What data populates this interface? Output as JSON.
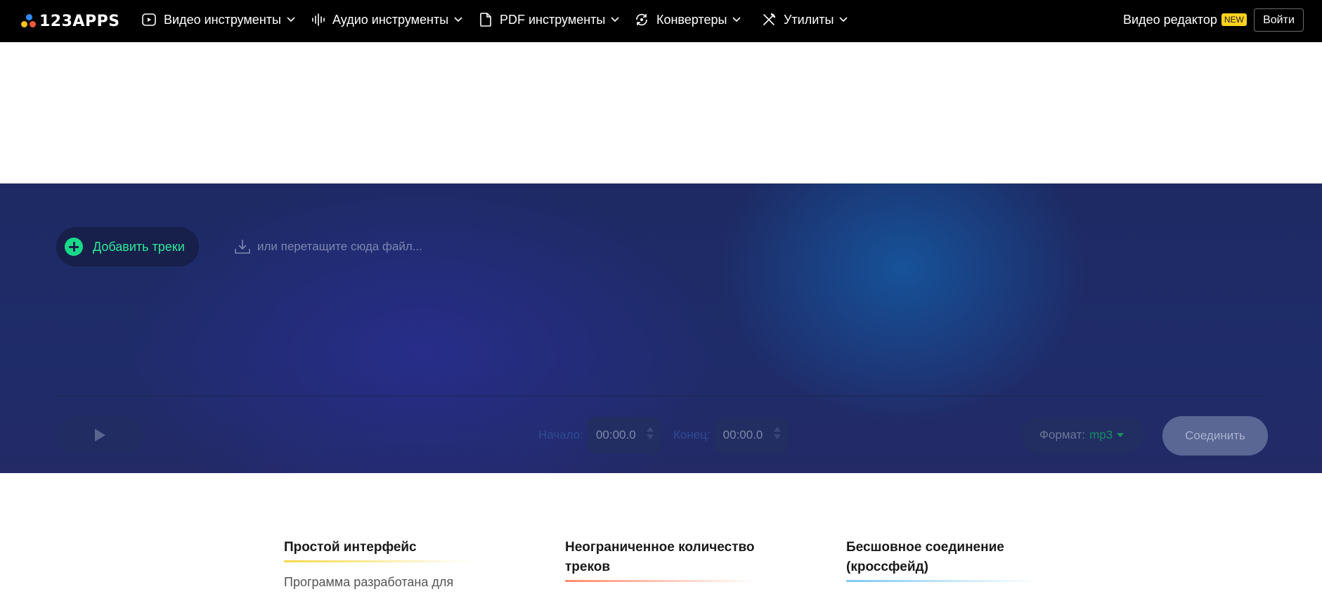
{
  "header": {
    "logo_text": "123APPS",
    "nav": [
      {
        "label": "Видео инструменты",
        "icon": "video-icon"
      },
      {
        "label": "Аудио инструменты",
        "icon": "audio-icon"
      },
      {
        "label": "PDF инструменты",
        "icon": "pdf-icon"
      },
      {
        "label": "Конвертеры",
        "icon": "converter-icon"
      },
      {
        "label": "Утилиты",
        "icon": "utilities-icon"
      }
    ],
    "video_editor_label": "Видео редактор",
    "new_badge": "NEW",
    "login_label": "Войти"
  },
  "tool": {
    "add_tracks_label": "Добавить треки",
    "drop_hint": "или перетащите сюда файл...",
    "start_label": "Начало:",
    "start_value": "00:00.0",
    "end_label": "Конец:",
    "end_value": "00:00.0",
    "format_label": "Формат:",
    "format_value": "mp3",
    "join_label": "Соединить"
  },
  "features": [
    {
      "title": "Простой интерфейс",
      "description": "Программа разработана для",
      "accent": "#f5d94a"
    },
    {
      "title": "Неограниченное количество треков",
      "description": "",
      "accent": "#ff8a6a"
    },
    {
      "title": "Бесшовное соединение (кроссфейд)",
      "description": "",
      "accent": "#7cc8f5"
    }
  ],
  "colors": {
    "header_bg": "#000000",
    "tool_bg": "#1f2c6a",
    "accent_green": "#2ee89a",
    "badge_yellow": "#ffd21e"
  }
}
